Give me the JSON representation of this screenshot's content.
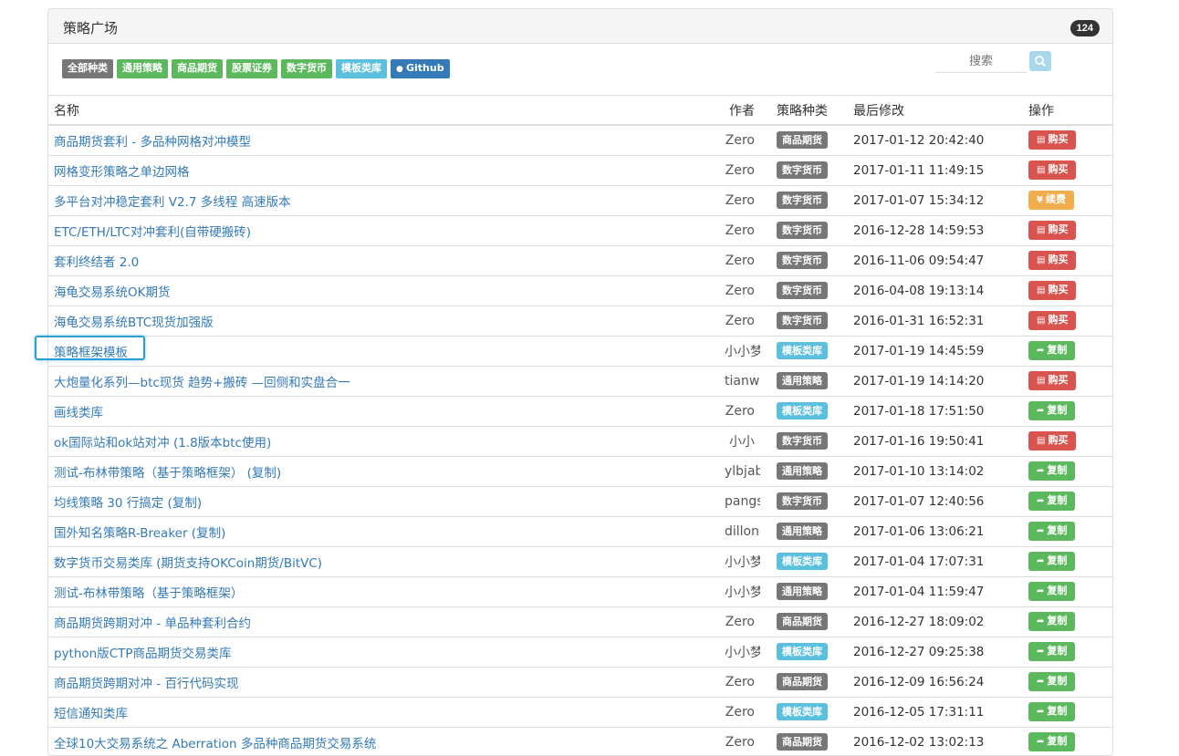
{
  "header": {
    "title": "策略广场",
    "count": "124"
  },
  "filters": [
    {
      "label": "全部种类",
      "color": "#777777"
    },
    {
      "label": "通用策略",
      "color": "#5cb85c"
    },
    {
      "label": "商品期货",
      "color": "#5cb85c"
    },
    {
      "label": "股票证券",
      "color": "#5cb85c"
    },
    {
      "label": "数字货币",
      "color": "#5cb85c"
    },
    {
      "label": "模板类库",
      "color": "#5bc0de"
    },
    {
      "label": "Github",
      "color": "#337ab7"
    }
  ],
  "search": {
    "placeholder": "搜索"
  },
  "table": {
    "headers": {
      "name": "名称",
      "author": "作者",
      "category": "策略种类",
      "modified": "最后修改",
      "action": "操作"
    },
    "rows": [
      {
        "name": "商品期货套利 - 多品种网格对冲模型",
        "author": "Zero",
        "category": "商品期货",
        "category_color": "#777777",
        "modified": "2017-01-12 20:42:40",
        "action": "购买",
        "action_icon": "cart-icon",
        "action_color": "#d9534f"
      },
      {
        "name": "网格变形策略之单边网格",
        "author": "Zero",
        "category": "数字货币",
        "category_color": "#777777",
        "modified": "2017-01-11 11:49:15",
        "action": "购买",
        "action_icon": "cart-icon",
        "action_color": "#d9534f"
      },
      {
        "name": "多平台对冲稳定套利 V2.7 多线程 高速版本",
        "author": "Zero",
        "category": "数字货币",
        "category_color": "#777777",
        "modified": "2017-01-07 15:34:12",
        "action": "续费",
        "action_icon": "yen-icon",
        "action_color": "#f0ad4e"
      },
      {
        "name": "ETC/ETH/LTC对冲套利(自带硬搬砖)",
        "author": "Zero",
        "category": "数字货币",
        "category_color": "#777777",
        "modified": "2016-12-28 14:59:53",
        "action": "购买",
        "action_icon": "cart-icon",
        "action_color": "#d9534f"
      },
      {
        "name": "套利终结者 2.0",
        "author": "Zero",
        "category": "数字货币",
        "category_color": "#777777",
        "modified": "2016-11-06 09:54:47",
        "action": "购买",
        "action_icon": "cart-icon",
        "action_color": "#d9534f"
      },
      {
        "name": "海龟交易系统OK期货",
        "author": "Zero",
        "category": "数字货币",
        "category_color": "#777777",
        "modified": "2016-04-08 19:13:14",
        "action": "购买",
        "action_icon": "cart-icon",
        "action_color": "#d9534f"
      },
      {
        "name": "海龟交易系统BTC现货加强版",
        "author": "Zero",
        "category": "数字货币",
        "category_color": "#777777",
        "modified": "2016-01-31 16:52:31",
        "action": "购买",
        "action_icon": "cart-icon",
        "action_color": "#d9534f"
      },
      {
        "name": "策略框架模板",
        "author": "小小梦",
        "category": "模板类库",
        "category_color": "#5bc0de",
        "modified": "2017-01-19 14:45:59",
        "action": "复制",
        "action_icon": "share-icon",
        "action_color": "#5cb85c"
      },
      {
        "name": "大炮量化系列—btc现货 趋势+搬砖 —回侧和实盘合一",
        "author": "tianweifeng",
        "category": "通用策略",
        "category_color": "#777777",
        "modified": "2017-01-19 14:14:20",
        "action": "购买",
        "action_icon": "cart-icon",
        "action_color": "#d9534f"
      },
      {
        "name": "画线类库",
        "author": "Zero",
        "category": "模板类库",
        "category_color": "#5bc0de",
        "modified": "2017-01-18 17:51:50",
        "action": "复制",
        "action_icon": "share-icon",
        "action_color": "#5cb85c"
      },
      {
        "name": "ok国际站和ok站对冲 (1.8版本btc使用)",
        "author": "小小",
        "category": "数字货币",
        "category_color": "#777777",
        "modified": "2017-01-16 19:50:41",
        "action": "购买",
        "action_icon": "cart-icon",
        "action_color": "#d9534f"
      },
      {
        "name": "测试-布林带策略（基于策略框架） (复制)",
        "author": "ylbjabc",
        "category": "通用策略",
        "category_color": "#777777",
        "modified": "2017-01-10 13:14:02",
        "action": "复制",
        "action_icon": "share-icon",
        "action_color": "#5cb85c"
      },
      {
        "name": "均线策略 30 行搞定 (复制)",
        "author": "pangshe",
        "category": "数字货币",
        "category_color": "#777777",
        "modified": "2017-01-07 12:40:56",
        "action": "复制",
        "action_icon": "share-icon",
        "action_color": "#5cb85c"
      },
      {
        "name": "国外知名策略R-Breaker (复制)",
        "author": "dillonchen",
        "category": "通用策略",
        "category_color": "#777777",
        "modified": "2017-01-06 13:06:21",
        "action": "复制",
        "action_icon": "share-icon",
        "action_color": "#5cb85c"
      },
      {
        "name": "数字货币交易类库 (期货支持OKCoin期货/BitVC)",
        "author": "小小梦",
        "category": "模板类库",
        "category_color": "#5bc0de",
        "modified": "2017-01-04 17:07:31",
        "action": "复制",
        "action_icon": "share-icon",
        "action_color": "#5cb85c"
      },
      {
        "name": "测试-布林带策略（基于策略框架）",
        "author": "小小梦",
        "category": "通用策略",
        "category_color": "#777777",
        "modified": "2017-01-04 11:59:47",
        "action": "复制",
        "action_icon": "share-icon",
        "action_color": "#5cb85c"
      },
      {
        "name": "商品期货跨期对冲 - 单品种套利合约",
        "author": "Zero",
        "category": "商品期货",
        "category_color": "#777777",
        "modified": "2016-12-27 18:09:02",
        "action": "复制",
        "action_icon": "share-icon",
        "action_color": "#5cb85c"
      },
      {
        "name": "python版CTP商品期货交易类库",
        "author": "小小梦",
        "category": "模板类库",
        "category_color": "#5bc0de",
        "modified": "2016-12-27 09:25:38",
        "action": "复制",
        "action_icon": "share-icon",
        "action_color": "#5cb85c"
      },
      {
        "name": "商品期货跨期对冲 - 百行代码实现",
        "author": "Zero",
        "category": "商品期货",
        "category_color": "#777777",
        "modified": "2016-12-09 16:56:24",
        "action": "复制",
        "action_icon": "share-icon",
        "action_color": "#5cb85c"
      },
      {
        "name": "短信通知类库",
        "author": "Zero",
        "category": "模板类库",
        "category_color": "#5bc0de",
        "modified": "2016-12-05 17:31:11",
        "action": "复制",
        "action_icon": "share-icon",
        "action_color": "#5cb85c"
      },
      {
        "name": "全球10大交易系统之 Aberration 多品种商品期货交易系统",
        "author": "Zero",
        "category": "商品期货",
        "category_color": "#777777",
        "modified": "2016-12-02 13:02:13",
        "action": "复制",
        "action_icon": "share-icon",
        "action_color": "#5cb85c"
      }
    ]
  }
}
